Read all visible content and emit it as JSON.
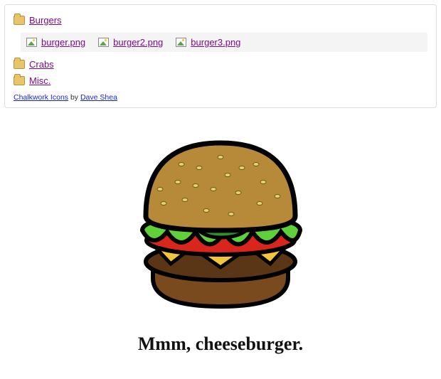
{
  "tree": {
    "folders": [
      {
        "label": "Burgers"
      },
      {
        "label": "Crabs"
      },
      {
        "label": "Misc."
      }
    ],
    "burger_files": [
      {
        "label": "burger.png"
      },
      {
        "label": "burger2.png"
      },
      {
        "label": "burger3.png"
      }
    ]
  },
  "credits": {
    "icons_link": "Chalkwork Icons",
    "by_text": " by ",
    "author_link": "Dave Shea"
  },
  "preview": {
    "caption": "Mmm, cheeseburger."
  }
}
